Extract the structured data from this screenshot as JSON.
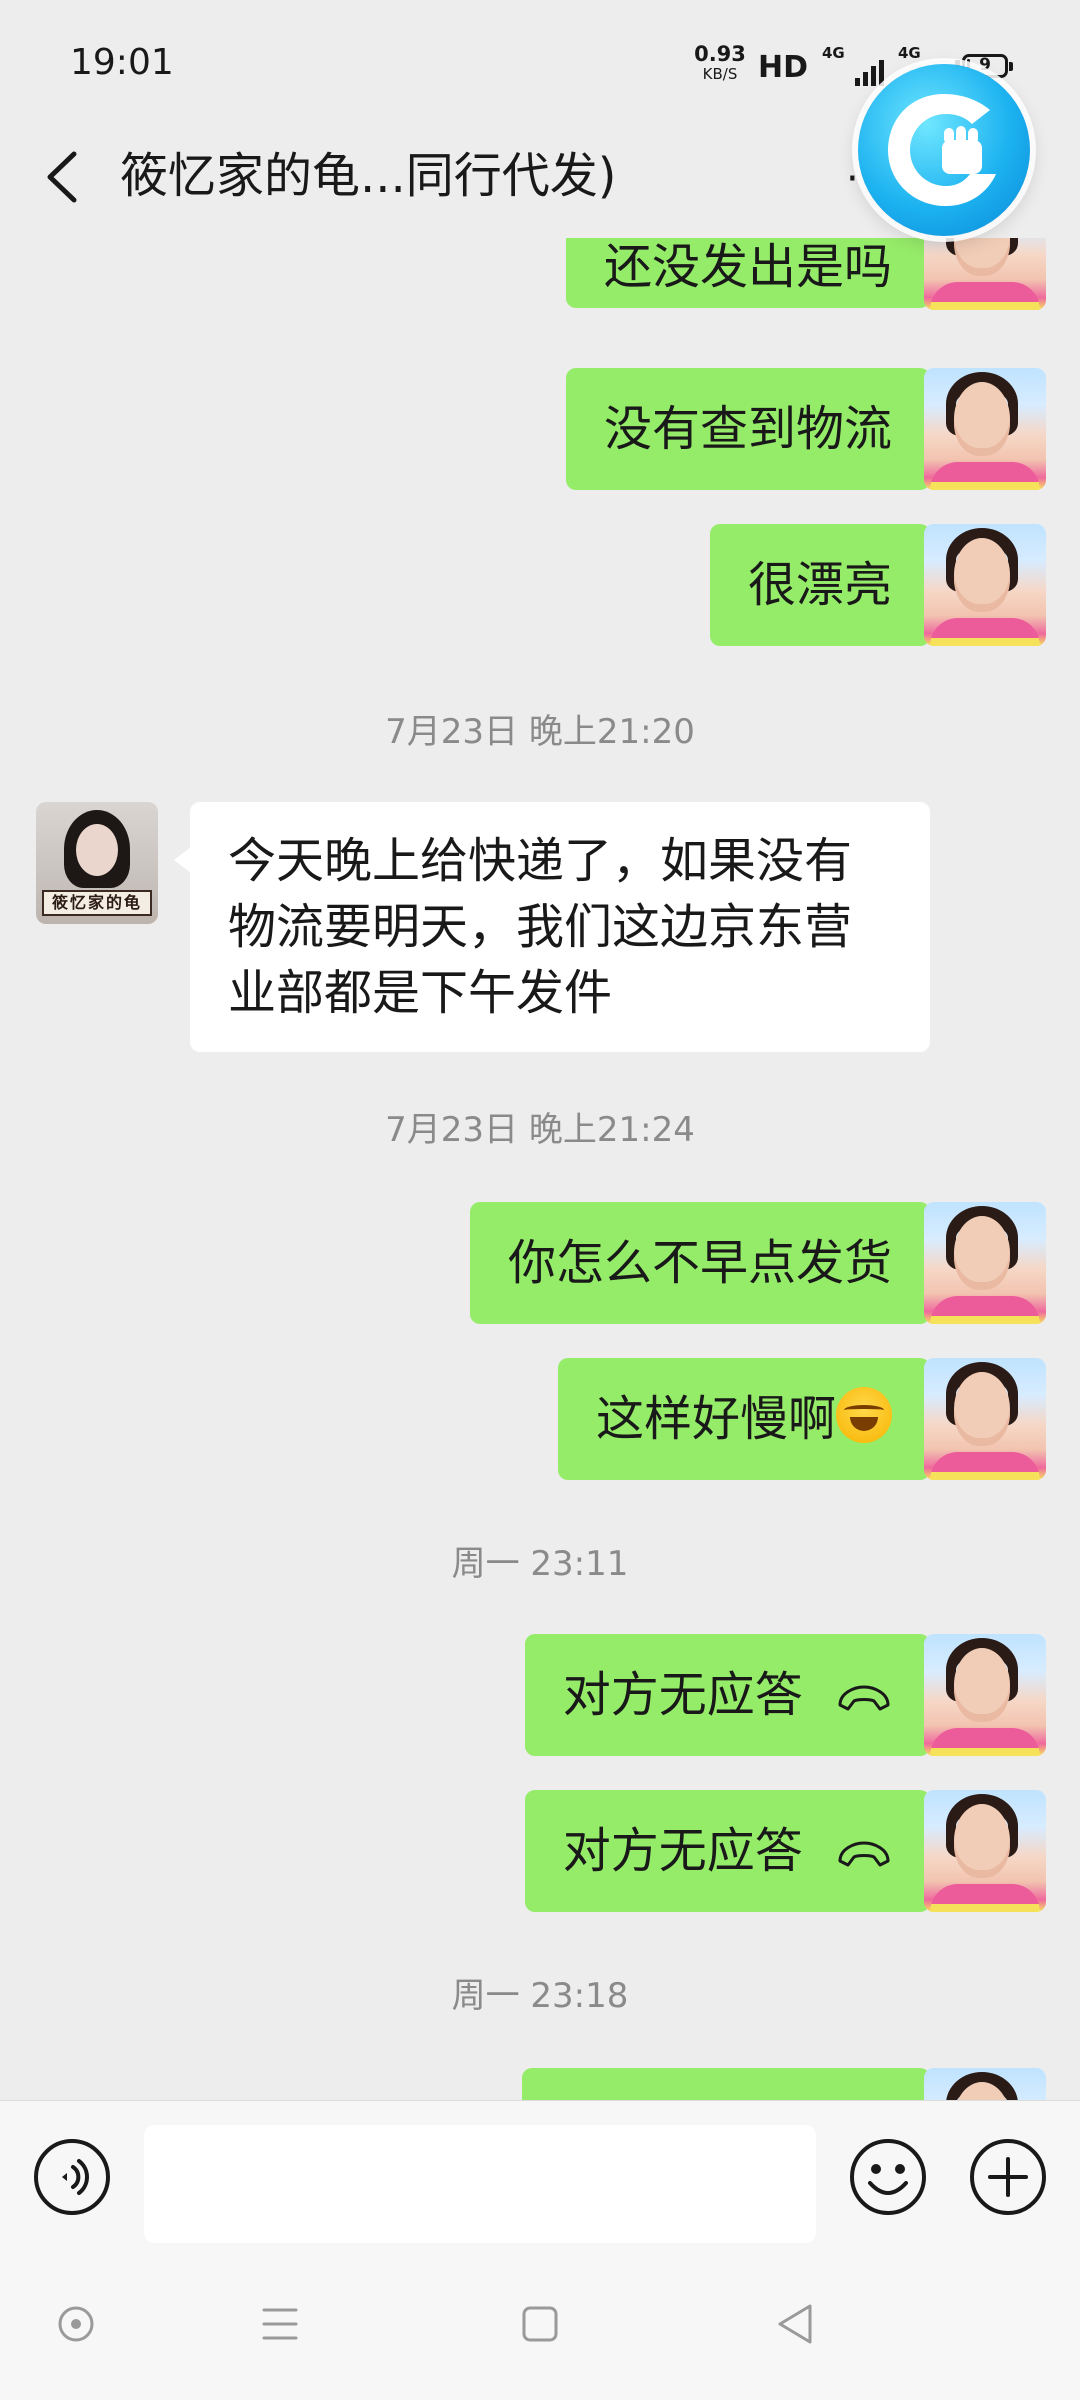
{
  "status_bar": {
    "time": "19:01",
    "net_speed": "0.93",
    "net_speed_unit": "KB/S",
    "hd": "HD",
    "sim1": "4G",
    "sim2": "4G",
    "battery": "9"
  },
  "header": {
    "title": "筱忆家的龟...同行代发)",
    "more": "·"
  },
  "messages": [
    {
      "side": "self",
      "text": "还没发出是吗"
    },
    {
      "side": "self",
      "text": "没有查到物流"
    },
    {
      "side": "self",
      "text": "很漂亮"
    },
    {
      "timestamp": "7月23日 晚上21:20"
    },
    {
      "side": "peer",
      "text": "今天晚上给快递了，如果没有物流要明天，我们这边京东营业部都是下午发件"
    },
    {
      "timestamp": "7月23日 晚上21:24"
    },
    {
      "side": "self",
      "text": "你怎么不早点发货"
    },
    {
      "side": "self",
      "text": "这样好慢啊",
      "emoji": "crying-laughing-face"
    },
    {
      "timestamp": "周一 23:11"
    },
    {
      "side": "self",
      "text": "对方无应答",
      "icon": "hang-up-phone"
    },
    {
      "side": "self",
      "text": "对方无应答",
      "icon": "hang-up-phone"
    },
    {
      "timestamp": "周一 23:18"
    },
    {
      "side": "self",
      "text": ""
    }
  ],
  "peer_avatar_caption": "筱忆家的龟",
  "input": {
    "value": "",
    "placeholder": ""
  },
  "colors": {
    "self_bubble": "#95ec69",
    "peer_bubble": "#ffffff",
    "background": "#ededed",
    "timestamp": "#8a8a8a"
  },
  "icons": {
    "back": "back-arrow-icon",
    "voice": "voice-icon",
    "emoji": "emoji-smile-icon",
    "plus": "plus-circle-icon",
    "nav_assist": "assistant-dot-icon",
    "nav_menu": "menu-lines-icon",
    "nav_home": "home-square-icon",
    "nav_back": "back-triangle-icon"
  }
}
